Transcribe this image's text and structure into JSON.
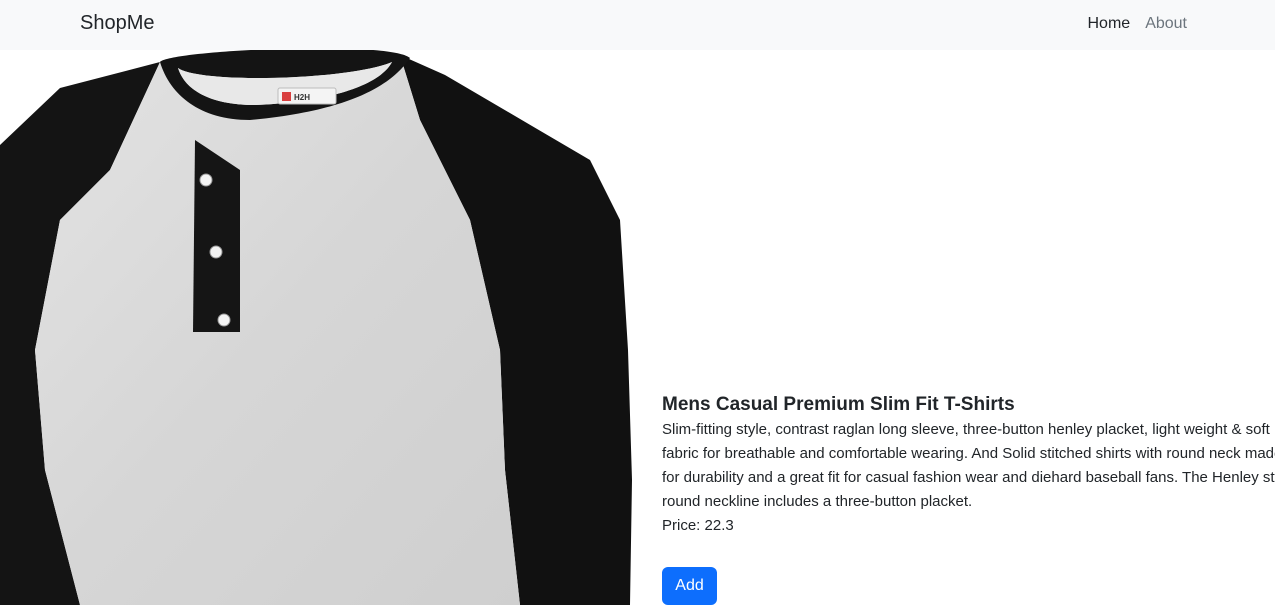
{
  "navbar": {
    "brand": "ShopMe",
    "links": [
      {
        "label": "Home"
      },
      {
        "label": "About"
      }
    ]
  },
  "product": {
    "image_label": "H2H",
    "title": "Mens Casual Premium Slim Fit T-Shirts",
    "description": "Slim-fitting style, contrast raglan long sleeve, three-button henley placket, light weight & soft fabric for breathable and comfortable wearing. And Solid stitched shirts with round neck made for durability and a great fit for casual fashion wear and diehard baseball fans. The Henley style round neckline includes a three-button placket.",
    "price_label": "Price:",
    "price": "22.3",
    "price_text": "Price: 22.3",
    "add_button": "Add"
  },
  "colors": {
    "navbar_bg": "#f8f9fa",
    "primary": "#0d6efd",
    "shirt_body": "#d9d9d9",
    "shirt_sleeve": "#111111"
  }
}
